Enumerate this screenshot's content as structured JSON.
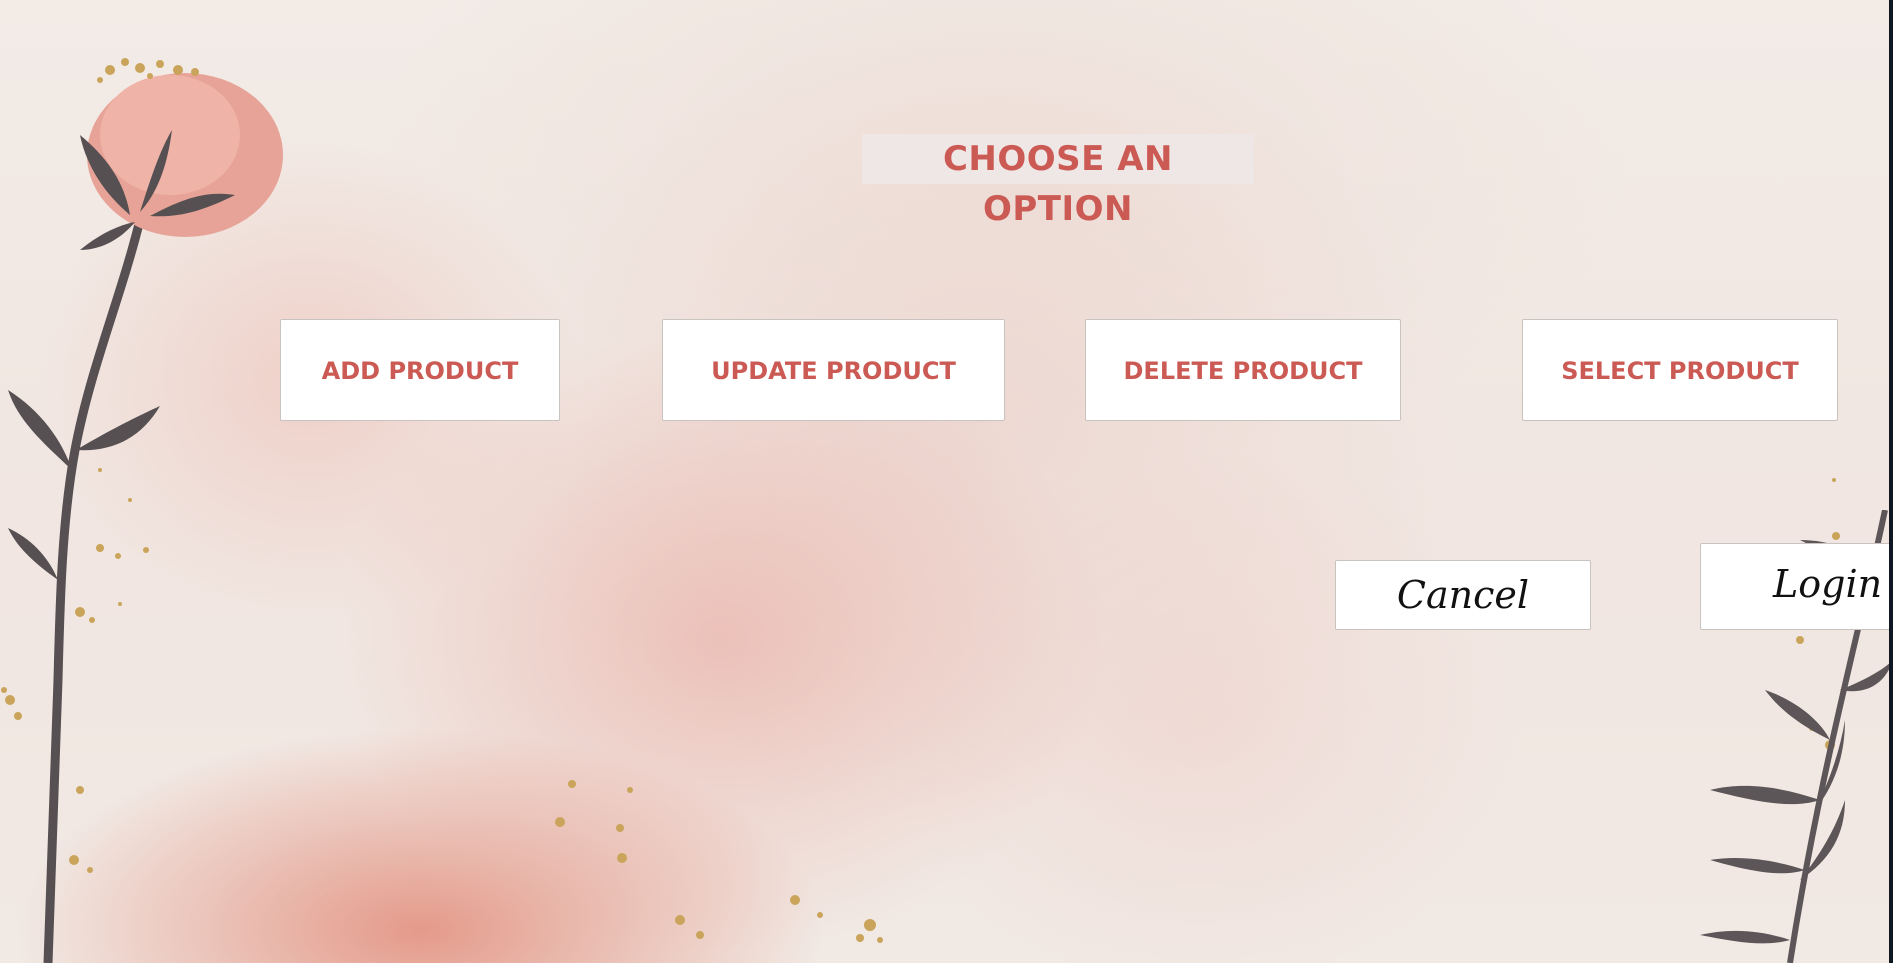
{
  "title": "CHOOSE AN OPTION",
  "options": [
    {
      "label": "ADD PRODUCT"
    },
    {
      "label": "UPDATE PRODUCT"
    },
    {
      "label": "DELETE PRODUCT"
    },
    {
      "label": "SELECT PRODUCT"
    }
  ],
  "actions": {
    "cancel_label": "Cancel",
    "login_label": "Login"
  },
  "colors": {
    "accent_text": "#cc5a54",
    "background": "#f3ece7",
    "button_bg": "#ffffff"
  }
}
